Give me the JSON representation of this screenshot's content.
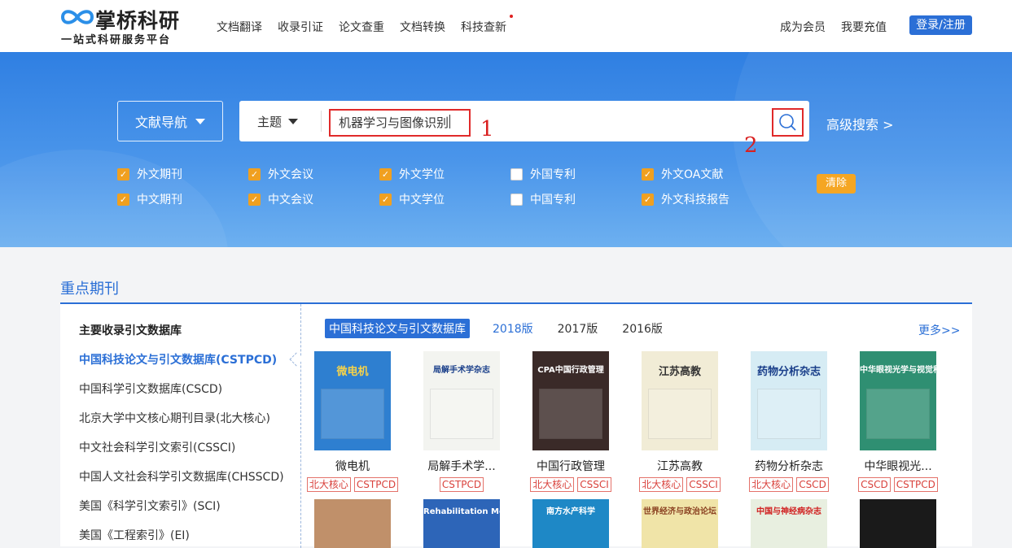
{
  "brand": {
    "name": "掌桥科研",
    "tagline": "一站式科研服务平台"
  },
  "nav": {
    "items": [
      "文档翻译",
      "收录引证",
      "论文查重",
      "文档转换",
      "科技查新"
    ]
  },
  "header_right": {
    "member": "成为会员",
    "recharge": "我要充值",
    "login": "登录/注册"
  },
  "search": {
    "nav_button": "文献导航",
    "field": "主题",
    "query": "机器学习与图像识别",
    "advanced": "高级搜索 >",
    "mark1": "1",
    "mark2": "2"
  },
  "filters": {
    "row1": [
      {
        "label": "外文期刊",
        "checked": true
      },
      {
        "label": "外文会议",
        "checked": true
      },
      {
        "label": "外文学位",
        "checked": true
      },
      {
        "label": "外国专利",
        "checked": false
      },
      {
        "label": "外文OA文献",
        "checked": true
      }
    ],
    "row2": [
      {
        "label": "中文期刊",
        "checked": true
      },
      {
        "label": "中文会议",
        "checked": true
      },
      {
        "label": "中文学位",
        "checked": true
      },
      {
        "label": "中国专利",
        "checked": false
      },
      {
        "label": "外文科技报告",
        "checked": true
      }
    ],
    "clear": "清除"
  },
  "section": {
    "title": "重点期刊"
  },
  "sidebar": {
    "heading": "主要收录引文数据库",
    "items": [
      "中国科技论文与引文数据库(CSTPCD)",
      "中国科学引文数据库(CSCD)",
      "北京大学中文核心期刊目录(北大核心)",
      "中文社会科学引文索引(CSSCI)",
      "中国人文社会科学引文数据库(CHSSCD)",
      "美国《科学引文索引》(SCI)",
      "美国《工程索引》(EI)"
    ]
  },
  "tabs": {
    "items": [
      "中国科技论文与引文数据库",
      "2018版",
      "2017版",
      "2016版"
    ],
    "more": "更多>>"
  },
  "journals": [
    {
      "name": "微电机",
      "tags": [
        "北大核心",
        "CSTPCD"
      ],
      "cover": {
        "title": "微电机",
        "bg": "#2e7fd0",
        "fg": "#f5d24a"
      }
    },
    {
      "name": "局解手术学...",
      "tags": [
        "CSTPCD"
      ],
      "cover": {
        "title": "局解手术学杂志",
        "bg": "#f3f4f0",
        "fg": "#1a3f8a"
      }
    },
    {
      "name": "中国行政管理",
      "tags": [
        "北大核心",
        "CSSCI"
      ],
      "cover": {
        "title": "CPA中国行政管理",
        "bg": "#3a2a28",
        "fg": "#ffffff"
      }
    },
    {
      "name": "江苏高教",
      "tags": [
        "北大核心",
        "CSSCI"
      ],
      "cover": {
        "title": "江苏高教",
        "bg": "#f1ecd6",
        "fg": "#333333"
      }
    },
    {
      "name": "药物分析杂志",
      "tags": [
        "北大核心",
        "CSCD"
      ],
      "cover": {
        "title": "药物分析杂志",
        "bg": "#d6ecf4",
        "fg": "#1a3f8a"
      }
    },
    {
      "name": "中华眼视光...",
      "tags": [
        "CSCD",
        "CSTPCD"
      ],
      "cover": {
        "title": "中华眼视光学与视觉科学杂志",
        "bg": "#2f8f72",
        "fg": "#ffffff"
      }
    }
  ],
  "journals_row2": [
    {
      "cover": {
        "title": "",
        "bg": "#c0906a",
        "fg": "#ffffff"
      }
    },
    {
      "cover": {
        "title": "Rehabilitation Medicine 康复学报",
        "bg": "#2d65b8",
        "fg": "#ffffff"
      }
    },
    {
      "cover": {
        "title": "南方水产科学",
        "bg": "#1e88c6",
        "fg": "#ffffff"
      }
    },
    {
      "cover": {
        "title": "世界经济与政治论坛",
        "bg": "#f0e4a8",
        "fg": "#8a4020"
      }
    },
    {
      "cover": {
        "title": "中国与神经病杂志",
        "bg": "#e8efe0",
        "fg": "#d02020"
      }
    },
    {
      "cover": {
        "title": "",
        "bg": "#1a1a1a",
        "fg": "#ffffff"
      }
    }
  ]
}
